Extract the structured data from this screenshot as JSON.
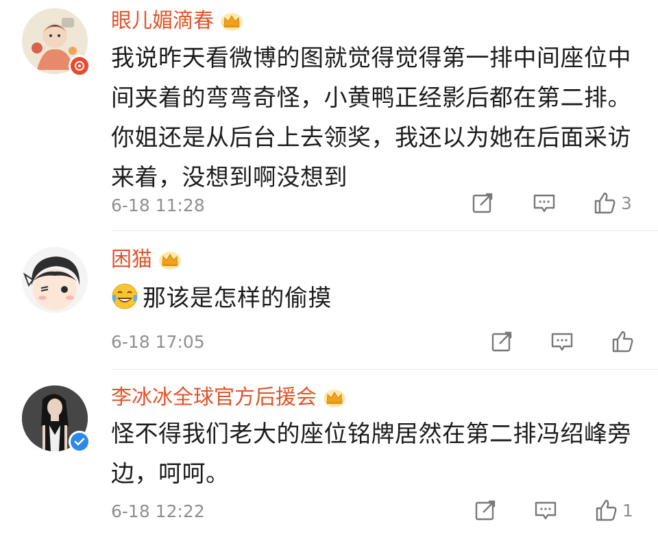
{
  "comments": [
    {
      "username": "眼儿媚滴春",
      "text": "我说昨天看微博的图就觉得觉得第一排中间座位中间夹着的弯弯奇怪，小黄鸭正经影后都在第二排。你姐还是从后台上去领奖，我还以为她在后面采访来着，没想到啊没想到",
      "timestamp": "6-18 11:28",
      "likes": "3",
      "badge": "red",
      "avatar": "illustrated-child-avatar"
    },
    {
      "username": "困猫",
      "text": "那该是怎样的偷摸",
      "emoji": "laughing-tears-emoji",
      "timestamp": "6-18 17:05",
      "likes": "",
      "avatar": "cartoon-face-avatar"
    },
    {
      "username": "李冰冰全球官方后援会",
      "text": "怪不得我们老大的座位铭牌居然在第二排冯绍峰旁边，呵呵。",
      "timestamp": "6-18 12:22",
      "likes": "1",
      "badge": "blue-verified",
      "avatar": "photo-woman-avatar"
    }
  ],
  "colors": {
    "username": "#e0542a",
    "meta": "#8f8f8f",
    "badge_red": "#e84a2f",
    "badge_blue": "#2e89e8"
  }
}
